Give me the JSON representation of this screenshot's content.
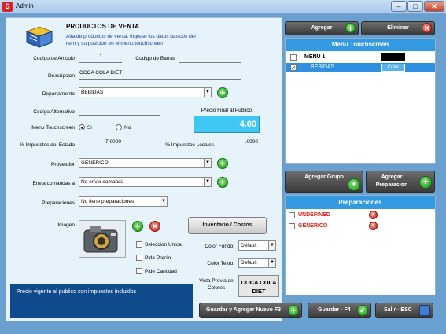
{
  "window": {
    "title": "Admin",
    "app_icon": "S",
    "minimize": "–",
    "maximize": "□",
    "close": "✕"
  },
  "header": {
    "title": "PRODUCTOS DE VENTA",
    "subtitle": "Alta de productos de venta. Ingrese los datos basicos del item y su posicion en el menu touchscreen",
    "icon": "book-icon"
  },
  "form": {
    "codigo_articulo": {
      "label": "Codigo de Articulo",
      "value": "1"
    },
    "codigo_barras": {
      "label": "Codigo de Barras",
      "value": ""
    },
    "descripcion": {
      "label": "Descripcion",
      "value": "COCA COLA DIET"
    },
    "departamento": {
      "label": "Departamento",
      "value": "BEBIDAS"
    },
    "codigo_alternativo": {
      "label": "Codigo Alternativo",
      "value": ""
    },
    "precio_final": {
      "label": "Precio Final al Publico",
      "value": "4.00"
    },
    "menu_touchscreen": {
      "label": "Menu Touchscreen",
      "yes": "Si",
      "no": "No",
      "selected": "Si"
    },
    "impuestos_estado": {
      "label": "% Impuestos del Estado",
      "value": "7.0000"
    },
    "impuestos_locales": {
      "label": "% Impuestos Locales",
      "value": ".0000"
    },
    "proveedor": {
      "label": "Proveedor",
      "value": "GENERICO"
    },
    "envia_comandas": {
      "label": "Envia comandas a",
      "value": "No envia comanda"
    },
    "preparaciones": {
      "label": "Preparaciones",
      "value": "No tiene preparaciones"
    },
    "imagen": {
      "label": "Imagen"
    },
    "inventario_button": "Inventario / Costos",
    "checks": [
      {
        "label": "Seleccion Unica",
        "checked": false
      },
      {
        "label": "Pide Precio",
        "checked": false
      },
      {
        "label": "Pide Cantidad",
        "checked": false
      }
    ],
    "color_fondo": {
      "label": "Color Fondo:",
      "value": "Default"
    },
    "color_texto": {
      "label": "Color Texto:",
      "value": "Default"
    },
    "vista_previa": {
      "label": "Vista Previa de Colores",
      "value": "COCA COLA DIET"
    }
  },
  "status": {
    "text": "Precio vigente al publico con impuestos incluidos"
  },
  "bottom_buttons": {
    "guardar_agregar": "Guardar y Agregar Nuevo F3",
    "guardar": "Guardar - F4",
    "salir": "Salir - ESC"
  },
  "menu_panel": {
    "agregar": "Agregar",
    "eliminar": "Eliminar",
    "title": "Menu Touchscreen",
    "items": [
      {
        "label": "MENU 1",
        "checked": false,
        "color": "#000000"
      },
      {
        "label": "BEBIDAS",
        "checked": true,
        "color_label": "Color"
      }
    ]
  },
  "prep_panel": {
    "agregar_grupo": "Agregar Grupo",
    "agregar_preparacion": "Agregar Preparacion",
    "title": "Preparaciones",
    "items": [
      {
        "label": "UNDEFINED"
      },
      {
        "label": "GENERICO"
      }
    ]
  },
  "colors": {
    "accent": "#3399e0",
    "price_box": "#3ec7f2",
    "status_bar": "#0e4a8c",
    "panel_bg": "#e6f3fa"
  }
}
